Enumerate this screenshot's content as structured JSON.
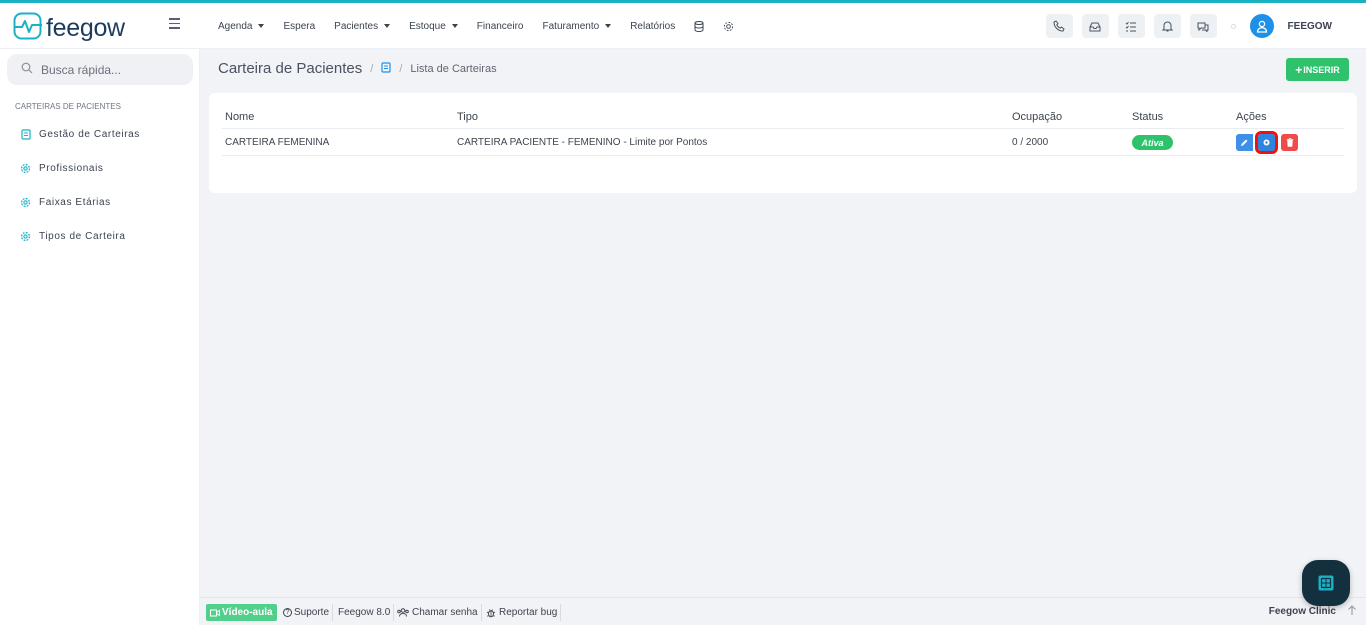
{
  "colors": {
    "accent": "#1bb1c4",
    "success": "#2dc26b",
    "primary": "#2f84df",
    "danger": "#f04b4b",
    "brand_dark": "#1c3c5e"
  },
  "brand": {
    "name": "feegow"
  },
  "nav": {
    "items": [
      {
        "label": "Agenda",
        "dropdown": true
      },
      {
        "label": "Espera",
        "dropdown": false
      },
      {
        "label": "Pacientes",
        "dropdown": true
      },
      {
        "label": "Estoque",
        "dropdown": true
      },
      {
        "label": "Financeiro",
        "dropdown": false
      },
      {
        "label": "Faturamento",
        "dropdown": true
      },
      {
        "label": "Relatórios",
        "dropdown": false
      }
    ],
    "icons": [
      "database-icon",
      "settings-icon"
    ]
  },
  "toolbar": {
    "icons": [
      "phone-icon",
      "inbox-icon",
      "checklist-icon",
      "bell-icon",
      "chat-icon"
    ]
  },
  "user": {
    "name": "FEEGOW",
    "icon": "user-icon"
  },
  "sidebar": {
    "search": {
      "placeholder": "Busca rápida..."
    },
    "header": "CARTEIRAS DE PACIENTES",
    "items": [
      {
        "label": "Gestão de Carteiras",
        "icon": "book-icon"
      },
      {
        "label": "Profissionais",
        "icon": "gear-icon"
      },
      {
        "label": "Faixas Etárias",
        "icon": "gear-icon"
      },
      {
        "label": "Tipos de Carteira",
        "icon": "gear-icon"
      }
    ]
  },
  "page": {
    "title": "Carteira de Pacientes",
    "breadcrumb_icon": "book-icon",
    "breadcrumb": "Lista de Carteiras",
    "insert_label": "INSERIR"
  },
  "table": {
    "columns": [
      "Nome",
      "Tipo",
      "Ocupação",
      "Status",
      "Ações"
    ],
    "rows": [
      {
        "nome": "CARTEIRA FEMENINA",
        "tipo": "CARTEIRA PACIENTE - FEMENINO - Limite por Pontos",
        "ocupacao": "0 / 2000",
        "status": "Ativa"
      }
    ],
    "actions": [
      "edit-icon",
      "gear-icon",
      "trash-icon"
    ]
  },
  "footer": {
    "video": "Vídeo-aula",
    "suporte": "Suporte",
    "version": "Feegow 8.0",
    "chamar": "Chamar senha",
    "bug": "Reportar bug",
    "clinic": "Feegow Clinic"
  }
}
